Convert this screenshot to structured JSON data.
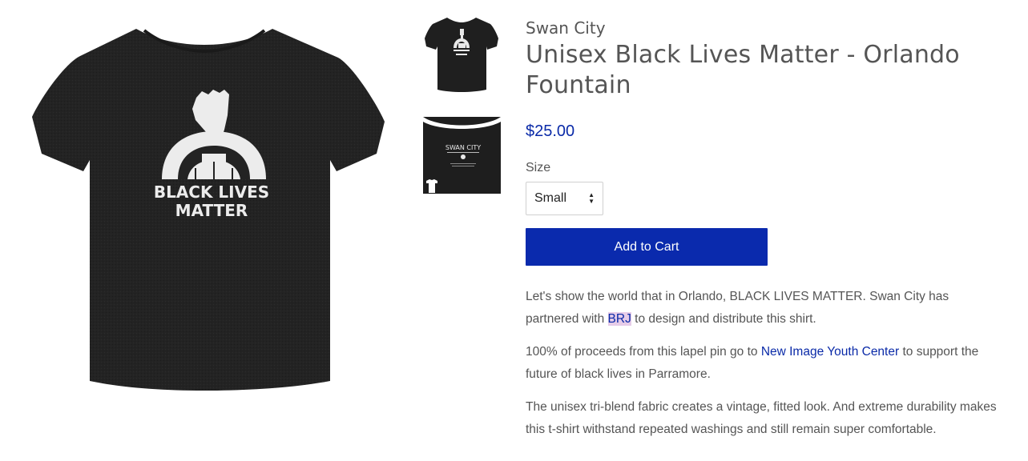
{
  "product": {
    "vendor": "Swan City",
    "title": "Unisex Black Lives Matter - Orlando Fountain",
    "price": "$25.00",
    "size_label": "Size",
    "size_selected": "Small",
    "add_to_cart": "Add to Cart",
    "shirt_text_line1": "BLACK LIVES",
    "shirt_text_line2": "MATTER",
    "back_print_text": "SWAN CITY"
  },
  "description": {
    "p1_before": "Let's show the world that in Orlando, BLACK LIVES MATTER. Swan City has partnered with ",
    "p1_link": "BRJ",
    "p1_after": " to design and distribute this shirt.",
    "p2_before": "100% of proceeds from this lapel pin go to ",
    "p2_link": "New Image Youth Center",
    "p2_after": " to support the future of black lives in Parramore.",
    "p3": "The unisex tri-blend fabric creates a vintage, fitted look. And extreme durability makes this t-shirt withstand repeated washings and still remain super comfortable."
  },
  "colors": {
    "accent": "#0a2aad",
    "shirt": "#222222",
    "text": "#555555",
    "highlight": "#e6cce8"
  }
}
